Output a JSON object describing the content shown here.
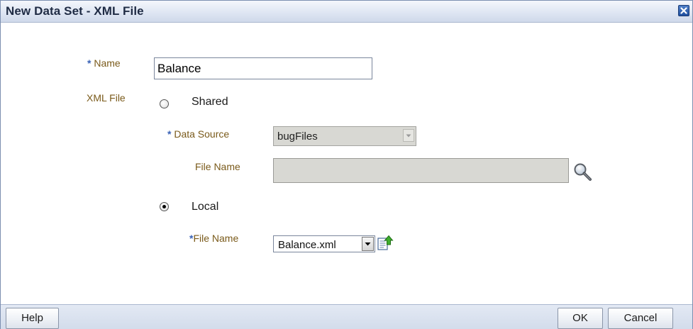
{
  "dialog": {
    "title": "New Data Set - XML File",
    "close_icon": "close-icon"
  },
  "form": {
    "name": {
      "required_mark": "*",
      "label": "Name",
      "value": "Balance"
    },
    "xml_file_label": "XML File",
    "shared": {
      "label": "Shared",
      "selected": false,
      "data_source": {
        "required_mark": "*",
        "label": "Data Source",
        "value": "bugFiles"
      },
      "file_name": {
        "label": "File Name",
        "value": "",
        "browse_icon": "magnifier-icon"
      }
    },
    "local": {
      "label": "Local",
      "selected": true,
      "file_name": {
        "required_mark": "*",
        "label": "File Name",
        "value": "Balance.xml",
        "upload_icon": "upload-icon"
      }
    }
  },
  "footer": {
    "help_label": "Help",
    "ok_label": "OK",
    "cancel_label": "Cancel"
  }
}
